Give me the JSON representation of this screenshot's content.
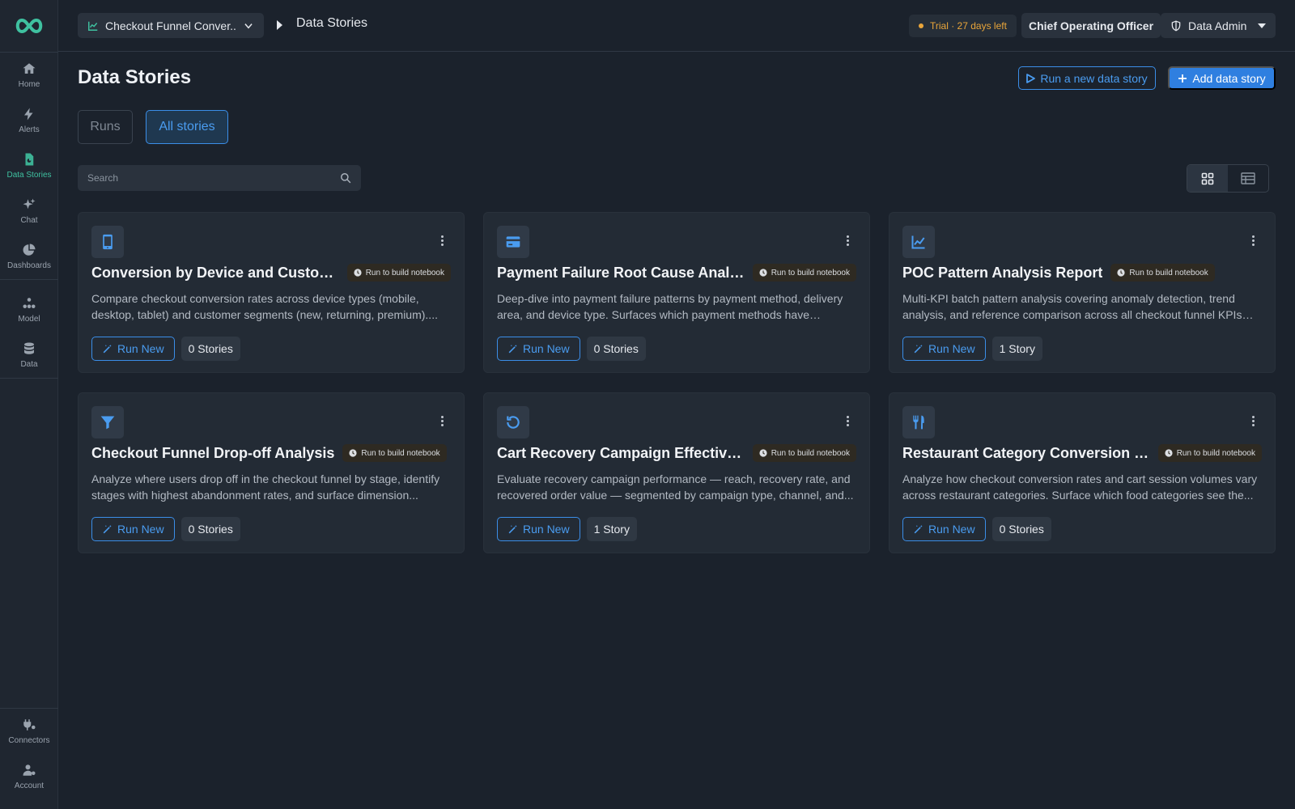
{
  "topbar": {
    "funnel_select": "Checkout Funnel Conver...",
    "breadcrumb_current": "Data Stories",
    "trial": "Trial · 27 days left",
    "role": "Chief Operating Officer",
    "admin": "Data Admin"
  },
  "sidebar": {
    "items": [
      {
        "label": "Home",
        "icon": "home-icon"
      },
      {
        "label": "Alerts",
        "icon": "lightning-icon"
      },
      {
        "label": "Data Stories",
        "icon": "data-stories-icon",
        "active": true
      },
      {
        "label": "Chat",
        "icon": "sparkle-icon"
      },
      {
        "label": "Dashboards",
        "icon": "pie-chart-icon"
      },
      {
        "label": "Model",
        "icon": "model-icon"
      },
      {
        "label": "Data",
        "icon": "database-icon"
      }
    ],
    "bottom_items": [
      {
        "label": "Connectors",
        "icon": "connectors-icon"
      },
      {
        "label": "Account",
        "icon": "account-icon"
      }
    ]
  },
  "main": {
    "title": "Data Stories",
    "run_new_story": "Run a new data story",
    "add_story": "Add data story",
    "tabs": [
      {
        "label": "Runs"
      },
      {
        "label": "All stories"
      }
    ],
    "search_placeholder": "Search",
    "badge_label": "Run to build notebook",
    "run_new_label": "Run New",
    "cards": [
      {
        "icon": "mobile-icon",
        "title": "Conversion by Device and Customer ...",
        "desc": "Compare checkout conversion rates across device types (mobile, desktop, tablet) and customer segments (new, returning, premium)....",
        "count": "0 Stories"
      },
      {
        "icon": "credit-card-icon",
        "title": "Payment Failure Root Cause Analysis",
        "desc": "Deep-dive into payment failure patterns by payment method, delivery area, and device type. Surfaces which payment methods have highest...",
        "count": "0 Stories"
      },
      {
        "icon": "line-chart-icon",
        "title": "POC Pattern Analysis Report",
        "desc": "Multi-KPI batch pattern analysis covering anomaly detection, trend analysis, and reference comparison across all checkout funnel KPIs for...",
        "count": "1 Story"
      },
      {
        "icon": "filter-icon",
        "title": "Checkout Funnel Drop-off Analysis",
        "desc": "Analyze where users drop off in the checkout funnel by stage, identify stages with highest abandonment rates, and surface dimension...",
        "count": "0 Stories"
      },
      {
        "icon": "refresh-icon",
        "title": "Cart Recovery Campaign Effectiven...",
        "desc": "Evaluate recovery campaign performance — reach, recovery rate, and recovered order value — segmented by campaign type, channel, and...",
        "count": "1 Story"
      },
      {
        "icon": "utensils-icon",
        "title": "Restaurant Category Conversion Tre...",
        "desc": "Analyze how checkout conversion rates and cart session volumes vary across restaurant categories. Surface which food categories see the...",
        "count": "0 Stories"
      }
    ]
  },
  "colors": {
    "accent": "#3b8ee8",
    "brand": "#3fc1a0",
    "trial": "#e9a53a",
    "background": "#1b222c",
    "card": "#232b35"
  }
}
